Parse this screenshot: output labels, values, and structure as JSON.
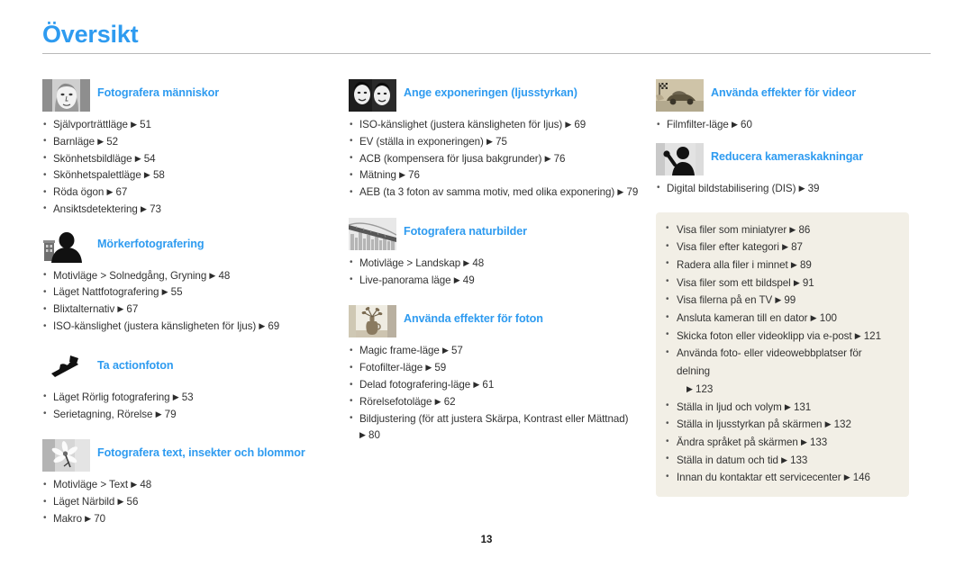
{
  "document": {
    "title": "Översikt",
    "page_number": "13",
    "accent_color": "#2e9bf0",
    "panel_color": "#f2efe6",
    "text_color": "#323232"
  },
  "columns": [
    {
      "id": "column-1",
      "sections": [
        {
          "id": "fotografera-manniskor",
          "title": "Fotografera människor",
          "icon": "portrait-woman-thumbnail",
          "items": [
            {
              "label": "Självporträttläge",
              "page": "51"
            },
            {
              "label": "Barnläge",
              "page": "52"
            },
            {
              "label": "Skönhetsbildläge",
              "page": "54"
            },
            {
              "label": "Skönhetspalettläge",
              "page": "58"
            },
            {
              "label": "Röda ögon",
              "page": "67"
            },
            {
              "label": "Ansiktsdetektering",
              "page": "73"
            }
          ]
        },
        {
          "id": "morkerfotografering",
          "title": "Mörkerfotografering",
          "icon": "night-silhouette-thumbnail",
          "items": [
            {
              "label": "Motivläge > Solnedgång, Gryning",
              "page": "48"
            },
            {
              "label": "Läget Nattfotografering",
              "page": "55"
            },
            {
              "label": "Blixtalternativ",
              "page": "67"
            },
            {
              "label": "ISO-känslighet (justera känsligheten för ljus)",
              "page": "69"
            }
          ]
        },
        {
          "id": "ta-actionfoton",
          "title": "Ta actionfoton",
          "icon": "snowboarder-thumbnail",
          "items": [
            {
              "label": "Läget Rörlig fotografering",
              "page": "53"
            },
            {
              "label": "Serietagning, Rörelse",
              "page": "79"
            }
          ]
        },
        {
          "id": "fotografera-text-insekter-blommor",
          "title": "Fotografera text, insekter och blommor",
          "icon": "flower-macro-thumbnail",
          "items": [
            {
              "label": "Motivläge > Text",
              "page": "48"
            },
            {
              "label": "Läget Närbild",
              "page": "56"
            },
            {
              "label": "Makro",
              "page": "70"
            }
          ]
        }
      ]
    },
    {
      "id": "column-2",
      "sections": [
        {
          "id": "ange-exponeringen",
          "title": "Ange exponeringen (ljusstyrkan)",
          "icon": "two-faces-exposure-thumbnail",
          "items": [
            {
              "label": "ISO-känslighet (justera känsligheten för ljus)",
              "page": "69"
            },
            {
              "label": "EV (ställa in exponeringen)",
              "page": "75"
            },
            {
              "label": "ACB (kompensera för ljusa bakgrunder)",
              "page": "76"
            },
            {
              "label": "Mätning",
              "page": "76"
            },
            {
              "label": "AEB (ta 3 foton av samma motiv, med olika exponering)",
              "page": "79"
            }
          ]
        },
        {
          "id": "fotografera-naturbilder",
          "title": "Fotografera naturbilder",
          "icon": "bridge-landscape-thumbnail",
          "items": [
            {
              "label": "Motivläge > Landskap",
              "page": "48"
            },
            {
              "label": "Live-panorama läge",
              "page": "49"
            }
          ]
        },
        {
          "id": "anvanda-effekter-for-foton",
          "title": "Använda effekter för foton",
          "icon": "sepia-vase-thumbnail",
          "items": [
            {
              "label": "Magic frame-läge",
              "page": "57"
            },
            {
              "label": "Fotofilter-läge",
              "page": "59"
            },
            {
              "label": "Delad fotografering-läge",
              "page": "61"
            },
            {
              "label": "Rörelsefotoläge",
              "page": "62"
            },
            {
              "label": "Bildjustering (för att justera Skärpa, Kontrast eller Mättnad)",
              "page": "80"
            }
          ]
        }
      ]
    },
    {
      "id": "column-3",
      "sections": [
        {
          "id": "anvanda-effekter-for-videor",
          "title": "Använda effekter för videor",
          "icon": "sepia-car-video-thumbnail",
          "items": [
            {
              "label": "Filmfilter-läge",
              "page": "60"
            }
          ]
        },
        {
          "id": "reducera-kameraskakningar",
          "title": "Reducera kameraskakningar",
          "icon": "person-waving-thumbnail",
          "items": [
            {
              "label": "Digital bildstabilisering (DIS)",
              "page": "39"
            }
          ]
        }
      ],
      "panel": {
        "id": "playback-settings-panel",
        "items": [
          {
            "label": "Visa filer som miniatyrer",
            "page": "86"
          },
          {
            "label": "Visa filer efter kategori",
            "page": "87"
          },
          {
            "label": "Radera alla filer i minnet",
            "page": "89"
          },
          {
            "label": "Visa filer som ett bildspel",
            "page": "91"
          },
          {
            "label": "Visa filerna på en TV",
            "page": "99"
          },
          {
            "label": "Ansluta kameran till en dator",
            "page": "100"
          },
          {
            "label": "Skicka foton eller videoklipp via e-post",
            "page": "121"
          },
          {
            "label": "Använda foto- eller videowebbplatser för delning",
            "page": "123"
          },
          {
            "label": "Ställa in ljud och volym",
            "page": "131"
          },
          {
            "label": "Ställa in ljusstyrkan på skärmen",
            "page": "132"
          },
          {
            "label": "Ändra språket på skärmen",
            "page": "133"
          },
          {
            "label": "Ställa in datum och tid",
            "page": "133"
          },
          {
            "label": "Innan du kontaktar ett servicecenter",
            "page": "146"
          }
        ]
      }
    }
  ]
}
